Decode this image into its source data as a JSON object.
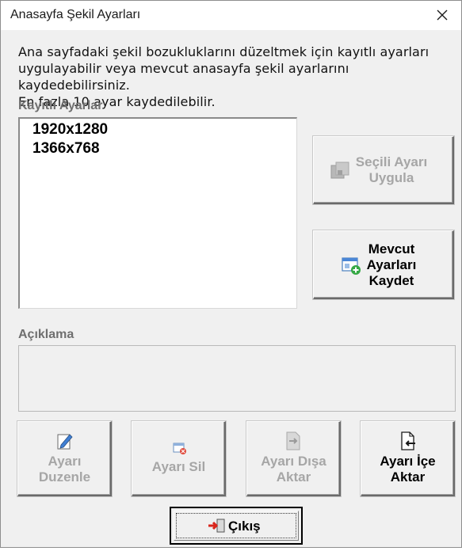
{
  "window": {
    "title": "Anasayfa Şekil Ayarları",
    "close_glyph": "✕"
  },
  "description": [
    "Ana sayfadaki şekil bozukluklarını düzeltmek için kayıtlı ayarları",
    "uygulayabilir veya mevcut anasayfa şekil ayarlarını kaydedebilirsiniz.",
    "En fazla 10 ayar kaydedilebilir."
  ],
  "saved_settings": {
    "label": "Kayıtlı Ayarlar",
    "items": [
      "1920x1280",
      "1366x768"
    ]
  },
  "buttons": {
    "apply_selected": {
      "line1": "Seçili Ayarı",
      "line2": "Uygula",
      "enabled": false
    },
    "save_current": {
      "line1": "Mevcut",
      "line2": "Ayarları",
      "line3": "Kaydet",
      "enabled": true
    },
    "edit": {
      "line1": "Ayarı",
      "line2": "Duzenle",
      "enabled": false
    },
    "delete": {
      "label": "Ayarı Sil",
      "enabled": false
    },
    "export": {
      "line1": "Ayarı Dışa",
      "line2": "Aktar",
      "enabled": false
    },
    "import": {
      "line1": "Ayarı İçe",
      "line2": "Aktar",
      "enabled": true
    },
    "exit": {
      "label": "Çıkış"
    }
  },
  "explanation": {
    "label": "Açıklama",
    "text": ""
  },
  "colors": {
    "dialog_bg": "#f0f0f0",
    "disabled_text": "#a6a6a6",
    "label_gray": "#6f6f6f",
    "exit_icon_red": "#d9261c"
  }
}
